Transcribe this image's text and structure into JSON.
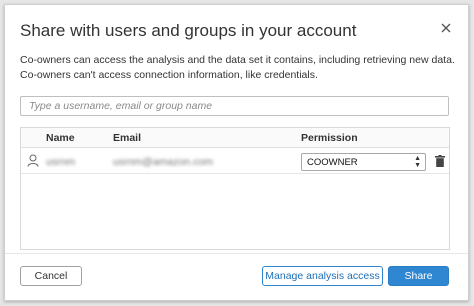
{
  "dialog": {
    "title": "Share with users and groups in your account",
    "description_line1": "Co-owners can access the analysis and the data set it contains, including retrieving new data.",
    "description_line2": "Co-owners can't access connection information, like credentials."
  },
  "search": {
    "placeholder": "Type a username, email or group name"
  },
  "table": {
    "columns": [
      "Name",
      "Email",
      "Permission"
    ],
    "rows": [
      {
        "name": "usrnm",
        "email": "usrnm@amazon.com",
        "permission": "COOWNER",
        "icon": "user-icon",
        "delete_icon": "trash-icon"
      }
    ]
  },
  "footer": {
    "cancel_label": "Cancel",
    "manage_label": "Manage analysis access",
    "share_label": "Share"
  },
  "colors": {
    "accent": "#2f86d1",
    "text": "#333333"
  }
}
